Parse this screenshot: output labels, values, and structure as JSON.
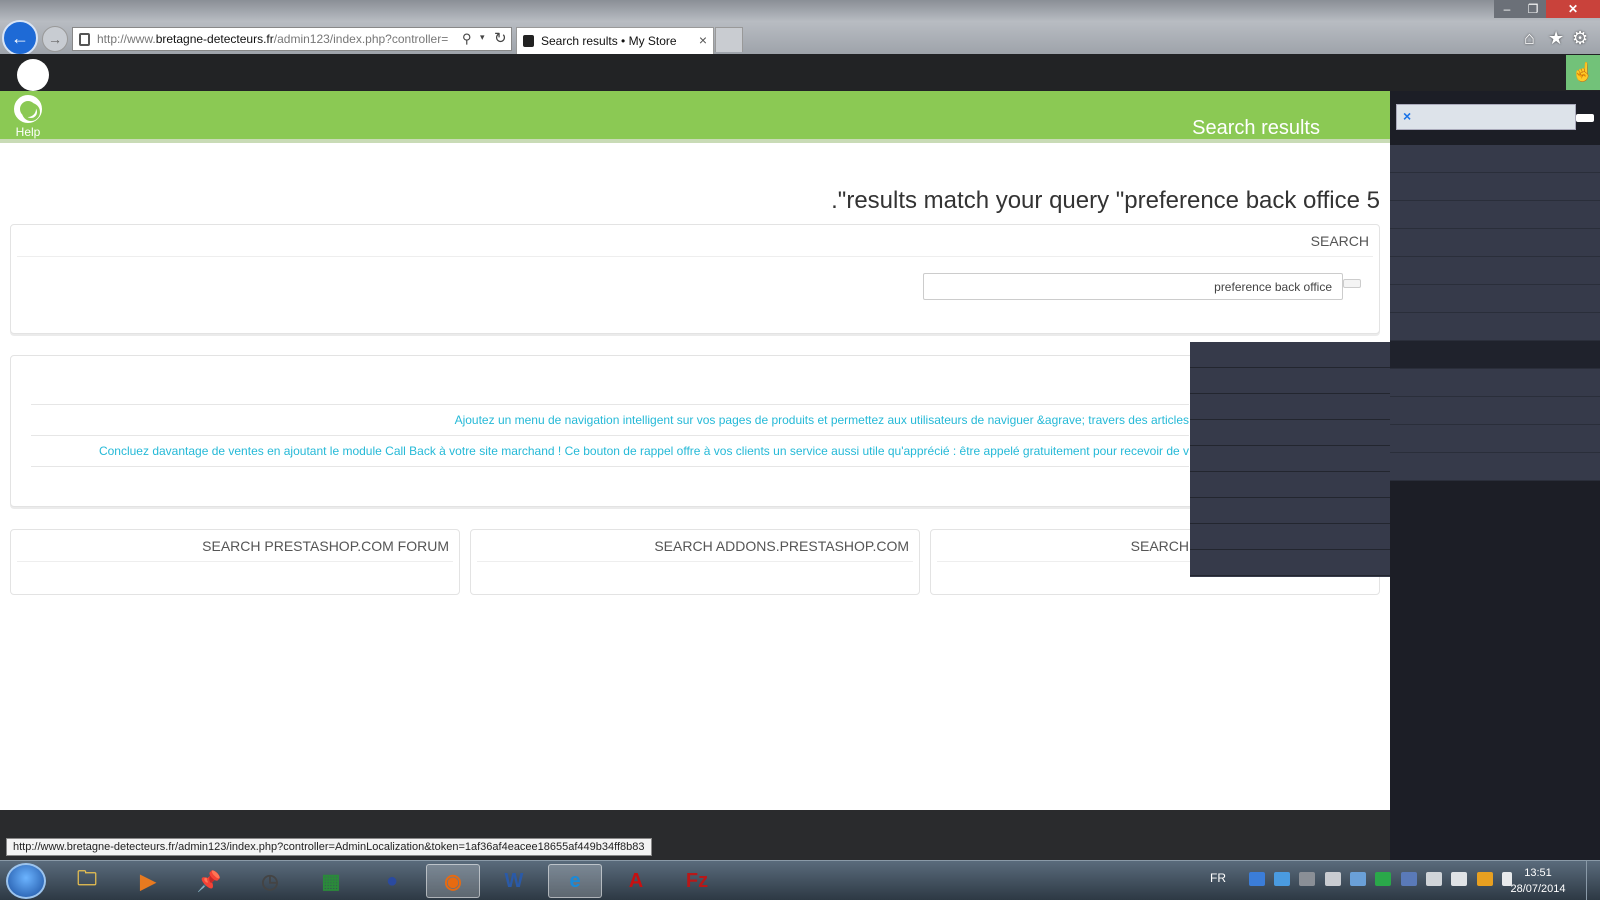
{
  "browser": {
    "address": {
      "prefix": "http://www.",
      "domain": "bretagne-detecteurs.fr",
      "path": "/admin123/index.php?controller="
    },
    "tab_title": "Search results • My Store",
    "tab_close": "×",
    "back": "←",
    "forward": "→",
    "window_controls": {
      "minimize": "–",
      "maximize": "❐",
      "close": "✕"
    },
    "toolbar_icons": {
      "home": "⌂",
      "favorites": "★",
      "tools": "⚙"
    },
    "address_icons": {
      "search": "⚲",
      "dropdown": "▾",
      "refresh": "↻"
    }
  },
  "toolbar": {
    "help_label": "Help",
    "page_title": "Search results"
  },
  "results": {
    "heading": ".\"results match your query \"preference back office 5"
  },
  "search_panel": {
    "heading": "SEARCH",
    "query": "preference back office"
  },
  "modules": [
    {
      "text": "Ajoutez un menu de navigation intelligent sur vos pages de produits et permettez aux utilisateurs de naviguer &agrave; travers des articles"
    },
    {
      "text": "Concluez davantage de ventes en ajoutant le module Call Back à votre site marchand !   Ce bouton de rappel offre à vos clients un service aussi utile qu'apprécié : être appelé gratuitement pour recevoir de v"
    }
  ],
  "external_search": [
    {
      "heading": "SEARCH PRESTASHOP.COM FORUM"
    },
    {
      "heading": "SEARCH ADDONS.PRESTASHOP.COM"
    },
    {
      "heading": "SEARCH"
    }
  ],
  "sidebar": {
    "clear_icon": "×"
  },
  "status_bar": {
    "url": "http://www.bretagne-detecteurs.fr/admin123/index.php?controller=AdminLocalization&token=1af36af4eacee18655af449b34ff8b83"
  },
  "taskbar": {
    "language": "FR",
    "time": "13:51",
    "date": "28/07/2014",
    "apps": [
      {
        "name": "explorer",
        "glyph": "🗀"
      },
      {
        "name": "media-player",
        "glyph": "▶"
      },
      {
        "name": "pin",
        "glyph": "📌"
      },
      {
        "name": "clock",
        "glyph": "◷"
      },
      {
        "name": "spreadsheet",
        "glyph": "▦"
      },
      {
        "name": "user",
        "glyph": "●"
      },
      {
        "name": "firefox",
        "glyph": "◉"
      },
      {
        "name": "word",
        "glyph": "W"
      },
      {
        "name": "internet-explorer",
        "glyph": "e"
      },
      {
        "name": "acrobat",
        "glyph": "A"
      },
      {
        "name": "filezilla",
        "glyph": "Fz"
      }
    ]
  },
  "colors": {
    "toolbar_green": "#8bc954",
    "link_blue": "#25b9d7",
    "sidebar_dark": "#1c1e26",
    "dropdown": "#363a4a",
    "admin_header": "#222325"
  }
}
